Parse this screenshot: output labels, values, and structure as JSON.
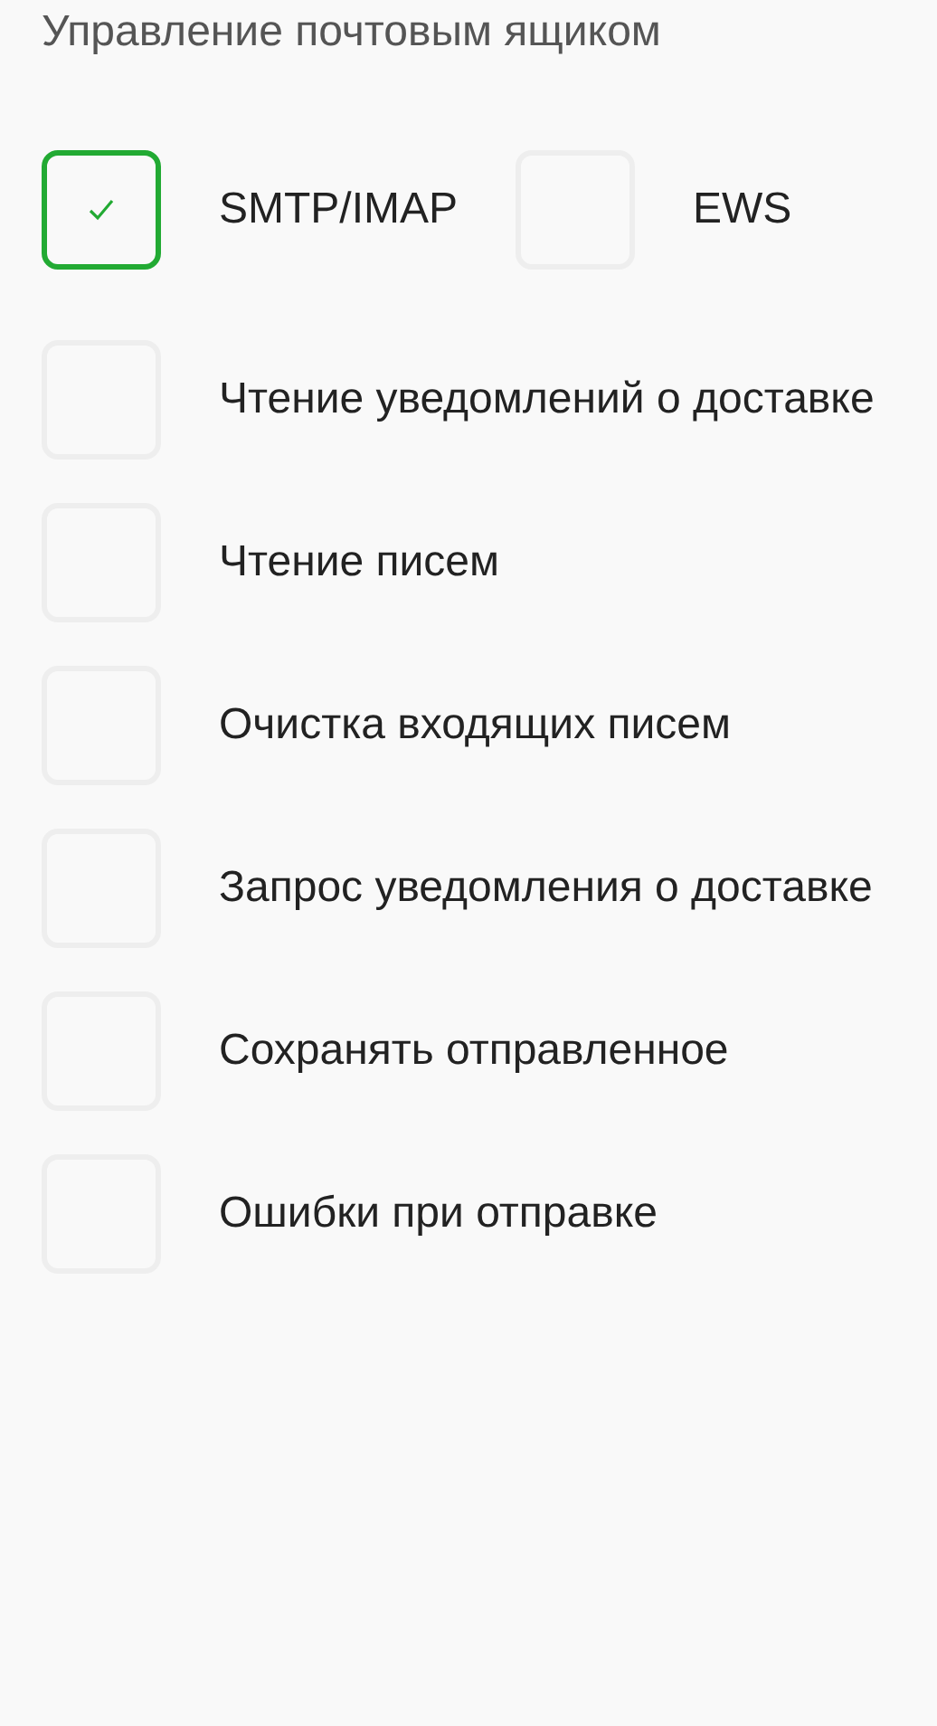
{
  "title": "Управление почтовым ящиком",
  "protocols": [
    {
      "label": "SMTP/IMAP",
      "checked": true
    },
    {
      "label": "EWS",
      "checked": false
    }
  ],
  "options": [
    {
      "label": "Чтение уведомлений о доставке",
      "checked": false
    },
    {
      "label": "Чтение писем",
      "checked": false
    },
    {
      "label": "Очистка входящих писем",
      "checked": false
    },
    {
      "label": "Запрос уведомления о доставке",
      "checked": false
    },
    {
      "label": "Сохранять отправленное",
      "checked": false
    },
    {
      "label": "Ошибки при отправке",
      "checked": false
    }
  ]
}
